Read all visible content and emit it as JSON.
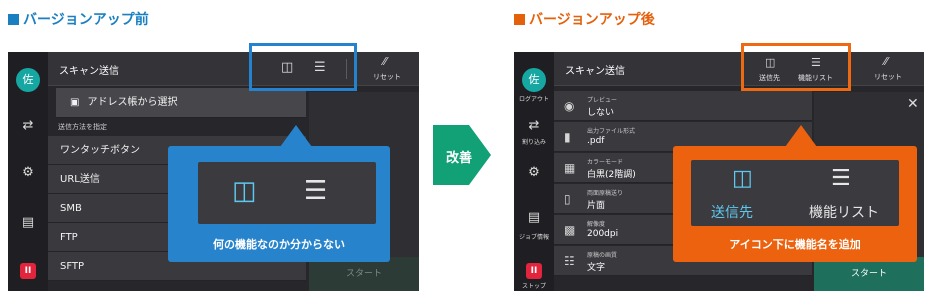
{
  "headings": {
    "before": "バージョンアップ前",
    "after": "バージョンアップ後"
  },
  "arrow_label": "改善",
  "colors": {
    "before_accent": "#2784cc",
    "after_accent": "#ec620e",
    "arrow": "#12a077",
    "avatar": "#17a7a3",
    "stop": "#e2243d"
  },
  "before": {
    "avatar": "佐",
    "title": "スキャン送信",
    "reset_label": "リセット",
    "menu": {
      "address_book": "アドレス帳から選択",
      "section_label": "送信方法を指定",
      "items": [
        "ワンタッチボタン",
        "URL送信",
        "SMB",
        "FTP",
        "SFTP"
      ]
    },
    "start_label": "スタート",
    "callout_caption": "何の機能なのか分からない",
    "icons": [
      "destination-icon",
      "settings-sliders-icon",
      "reset-icon",
      "address-book-icon",
      "scan-icon",
      "gear-icon",
      "job-status-icon",
      "stop-icon"
    ]
  },
  "after": {
    "avatar": "佐",
    "rail_labels": {
      "logout": "ログアウト",
      "interrupt": "割り込み",
      "job": "ジョブ情報",
      "stop": "ストップ"
    },
    "title": "スキャン送信",
    "tabs": {
      "destination": "送信先",
      "feature_list": "機能リスト",
      "reset": "リセット"
    },
    "settings": [
      {
        "label": "プレビュー",
        "value": "しない",
        "icon": "eye-icon"
      },
      {
        "label": "出力ファイル形式",
        "value": ".pdf",
        "icon": "file-icon"
      },
      {
        "label": "カラーモード",
        "value": "白黒(2階調)",
        "icon": "color-mode-icon"
      },
      {
        "label": "両面原稿送り",
        "value": "片面",
        "icon": "duplex-icon"
      },
      {
        "label": "解像度",
        "value": "200dpi",
        "icon": "resolution-icon"
      },
      {
        "label": "原稿の画質",
        "value": "文字",
        "icon": "image-quality-icon"
      }
    ],
    "start_label": "スタート",
    "callout": {
      "destination_label": "送信先",
      "feature_label": "機能リスト",
      "caption": "アイコン下に機能名を追加"
    }
  }
}
